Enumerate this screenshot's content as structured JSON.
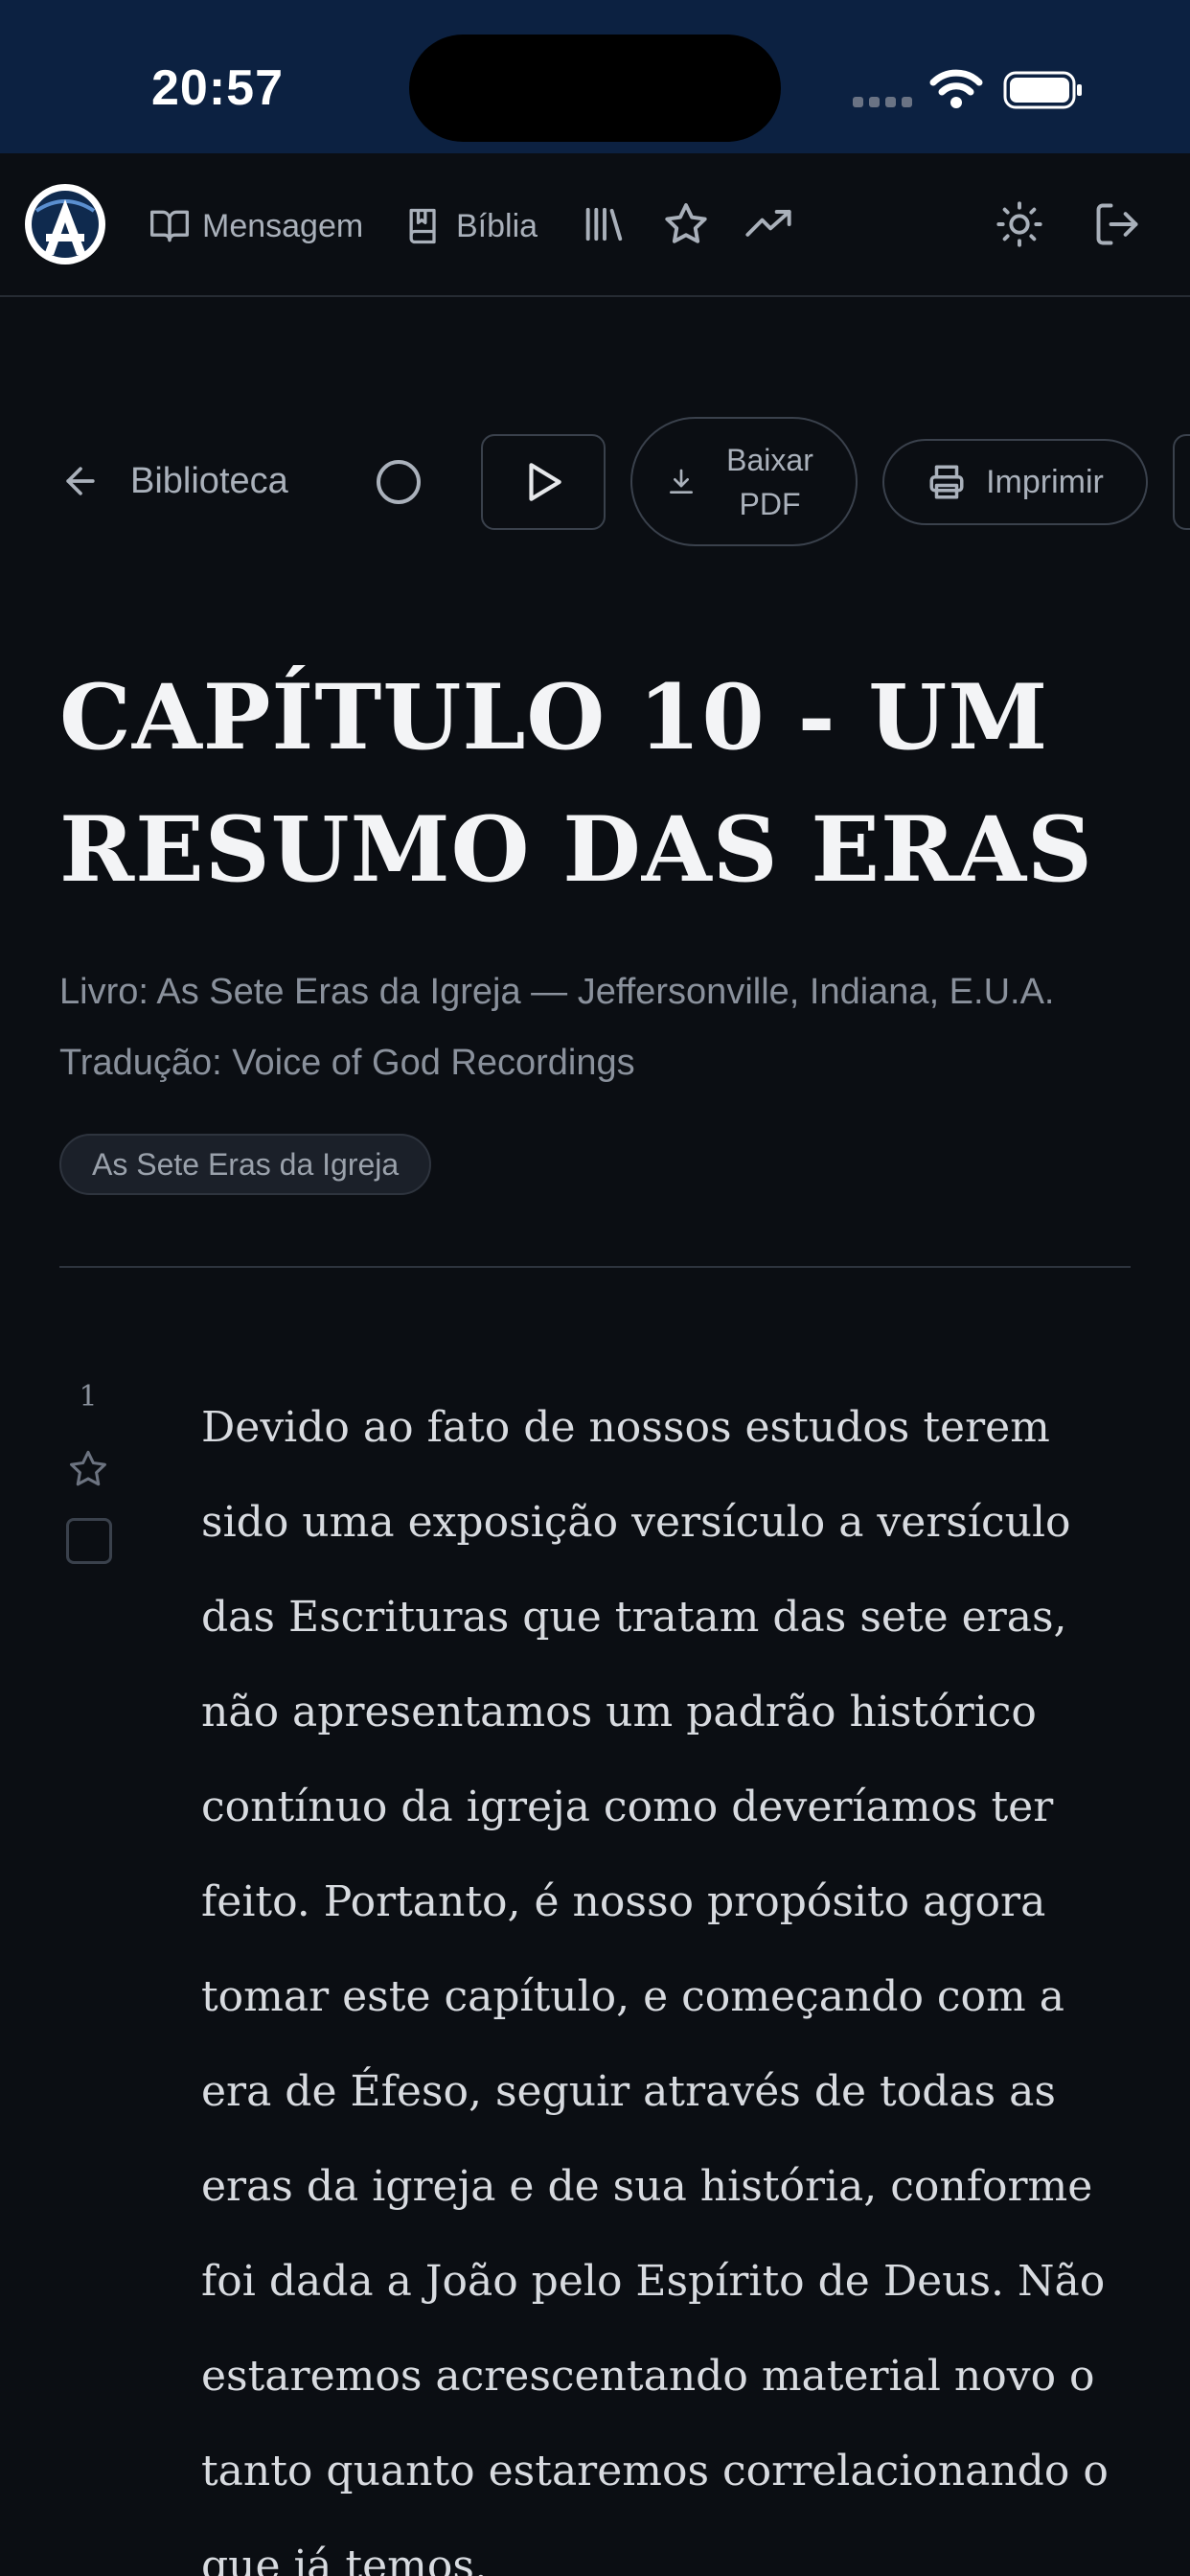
{
  "status_bar": {
    "time": "20:57"
  },
  "nav": {
    "items": [
      {
        "label": "Mensagem",
        "icon": "book-open-icon"
      },
      {
        "label": "Bíblia",
        "icon": "bible-icon"
      }
    ],
    "icons": [
      "library-icon",
      "star-icon",
      "trending-icon",
      "sun-icon",
      "logout-icon"
    ]
  },
  "toolbar": {
    "back_label": "Biblioteca",
    "pdf_label": "Baixar PDF",
    "print_label": "Imprimir"
  },
  "document": {
    "title": "CAPÍTULO 10 - UM RESUMO DAS ERAS",
    "book_line": "Livro: As Sete Eras da Igreja — Jeffersonville, Indiana, E.U.A.",
    "translation_line": "Tradução: Voice of God Recordings",
    "tag": "As Sete Eras da Igreja"
  },
  "paragraphs": [
    {
      "number": "1",
      "text": "Devido ao fato de nossos estudos terem sido uma exposição versículo a versículo das Escrituras que tratam das sete eras, não apresentamos um padrão histórico contínuo da igreja como deveríamos ter feito. Portanto, é nosso propósito agora tomar este capítulo, e começando com a era de Éfeso, seguir através de todas as eras da igreja e de sua história, conforme foi dada a João pelo Espírito de Deus. Não estaremos acrescentando material novo o tanto quanto estaremos correlacionando o que já temos."
    }
  ],
  "colors": {
    "status_bar": "#0c2141",
    "background": "#0b0e13",
    "text": "#d8dbe0",
    "muted": "#8a919c"
  }
}
